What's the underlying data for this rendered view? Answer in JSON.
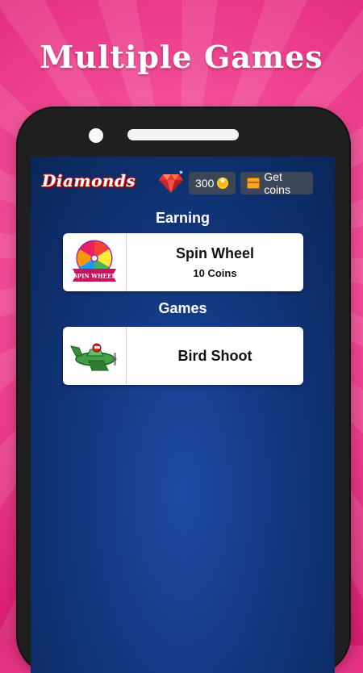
{
  "headline": "Multiple Games",
  "app": {
    "logo_text": "Diamonds",
    "coins": "300",
    "get_coins_label": "Get coins"
  },
  "sections": {
    "earning": {
      "title": "Earning",
      "card": {
        "title": "Spin Wheel",
        "subtitle": "10 Coins",
        "badge_text": "SPIN WHEEL"
      }
    },
    "games": {
      "title": "Games",
      "card": {
        "title": "Bird Shoot"
      }
    }
  },
  "icons": {
    "gem": "diamond-icon",
    "coin": "coin-icon",
    "chest": "treasure-chest-icon",
    "spin_wheel": "spin-wheel-icon",
    "plane": "airplane-icon"
  },
  "colors": {
    "background": "#f04591",
    "screen": "#103578",
    "pill": "#3b4756",
    "card": "#ffffff"
  }
}
